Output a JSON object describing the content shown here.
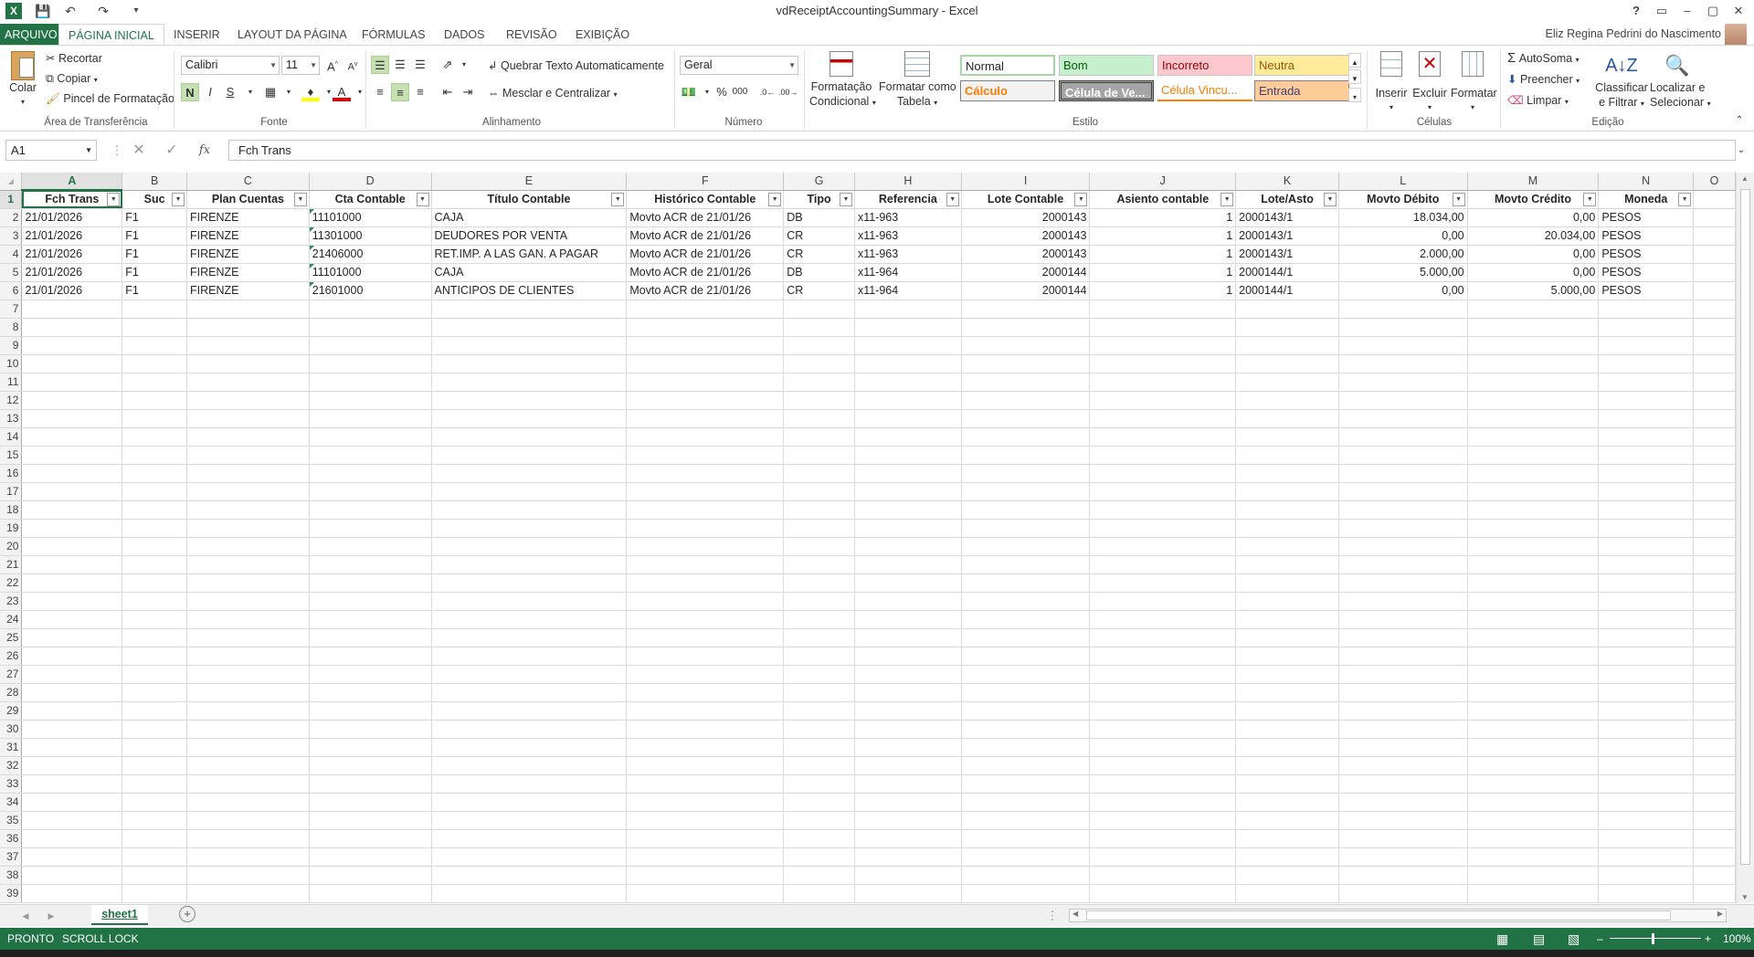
{
  "window": {
    "title": "vdReceiptAccountingSummary - Excel",
    "help": "?",
    "controls": [
      "–",
      "▢",
      "✕"
    ]
  },
  "tabs": {
    "file": "ARQUIVO",
    "items": [
      "PÁGINA INICIAL",
      "INSERIR",
      "LAYOUT DA PÁGINA",
      "FÓRMULAS",
      "DADOS",
      "REVISÃO",
      "EXIBIÇÃO"
    ],
    "user": "Eliz Regina Pedrini do Nascimento"
  },
  "ribbon": {
    "clipboard": {
      "paste": "Colar",
      "cut": "Recortar",
      "copy": "Copiar",
      "format_painter": "Pincel de Formatação",
      "label": "Área de Transferência"
    },
    "font": {
      "name": "Calibri",
      "size": "11",
      "bold": "N",
      "italic": "I",
      "underline": "S",
      "label": "Fonte"
    },
    "alignment": {
      "wrap": "Quebrar Texto Automaticamente",
      "merge": "Mesclar e Centralizar",
      "label": "Alinhamento"
    },
    "number": {
      "format": "Geral",
      "percent": "%",
      "thousands": "000",
      "label": "Número"
    },
    "styles": {
      "cond_format": [
        "Formatação",
        "Condicional"
      ],
      "format_table": [
        "Formatar como",
        "Tabela"
      ],
      "cells": [
        "Normal",
        "Bom",
        "Incorreto",
        "Neutra",
        "Cálculo",
        "Célula de Ve...",
        "Célula Vincu...",
        "Entrada"
      ],
      "label": "Estilo"
    },
    "cells": {
      "insert": "Inserir",
      "delete": "Excluir",
      "format": "Formatar",
      "label": "Células"
    },
    "editing": {
      "autosum": "AutoSoma",
      "fill": "Preencher",
      "clear": "Limpar",
      "sort": [
        "Classificar",
        "e Filtrar"
      ],
      "find": [
        "Localizar e",
        "Selecionar"
      ],
      "label": "Edição"
    }
  },
  "formula_bar": {
    "name_box": "A1",
    "fx": "fx",
    "content": "Fch Trans"
  },
  "columns": [
    "A",
    "B",
    "C",
    "D",
    "E",
    "F",
    "G",
    "H",
    "I",
    "J",
    "K",
    "L",
    "M",
    "N",
    "O"
  ],
  "headers": [
    "Fch Trans",
    "Suc",
    "Plan Cuentas",
    "Cta Contable",
    "Título Contable",
    "Histórico Contable",
    "Tipo",
    "Referencia",
    "Lote Contable",
    "Asiento contable",
    "Lote/Asto",
    "Movto Débito",
    "Movto Crédito",
    "Moneda"
  ],
  "rows": [
    [
      "21/01/2026",
      "F1",
      "FIRENZE",
      "11101000",
      "CAJA",
      "Movto ACR de 21/01/26",
      "DB",
      "x11-963",
      "2000143",
      "1",
      "2000143/1",
      "18.034,00",
      "0,00",
      "PESOS"
    ],
    [
      "21/01/2026",
      "F1",
      "FIRENZE",
      "11301000",
      "DEUDORES POR VENTA",
      "Movto ACR de 21/01/26",
      "CR",
      "x11-963",
      "2000143",
      "1",
      "2000143/1",
      "0,00",
      "20.034,00",
      "PESOS"
    ],
    [
      "21/01/2026",
      "F1",
      "FIRENZE",
      "21406000",
      "RET.IMP. A LAS GAN. A PAGAR",
      "Movto ACR de 21/01/26",
      "CR",
      "x11-963",
      "2000143",
      "1",
      "2000143/1",
      "2.000,00",
      "0,00",
      "PESOS"
    ],
    [
      "21/01/2026",
      "F1",
      "FIRENZE",
      "11101000",
      "CAJA",
      "Movto ACR de 21/01/26",
      "DB",
      "x11-964",
      "2000144",
      "1",
      "2000144/1",
      "5.000,00",
      "0,00",
      "PESOS"
    ],
    [
      "21/01/2026",
      "F1",
      "FIRENZE",
      "21601000",
      "ANTICIPOS DE CLIENTES",
      "Movto ACR de 21/01/26",
      "CR",
      "x11-964",
      "2000144",
      "1",
      "2000144/1",
      "0,00",
      "5.000,00",
      "PESOS"
    ]
  ],
  "total_rows": 39,
  "sheet_tab": "sheet1",
  "status": {
    "ready": "PRONTO",
    "scroll_lock": "SCROLL LOCK",
    "zoom": "100%"
  },
  "colors": {
    "excel_green": "#217346"
  }
}
